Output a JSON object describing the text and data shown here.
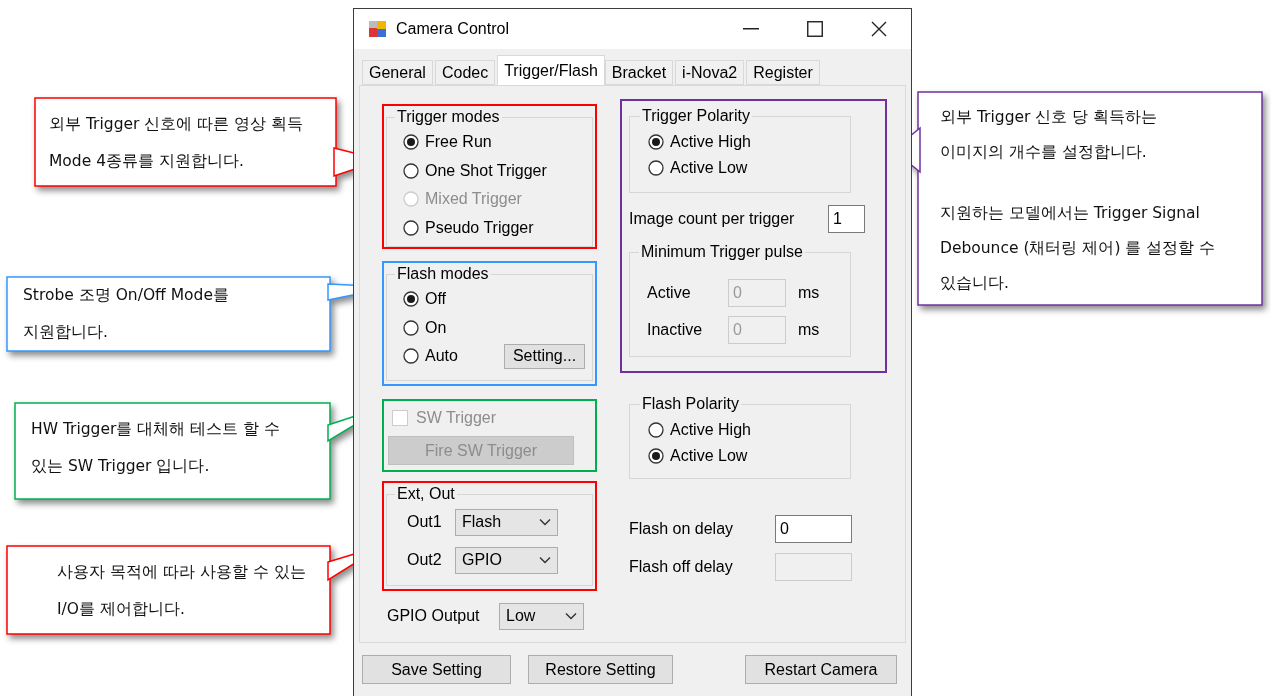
{
  "window": {
    "title": "Camera Control"
  },
  "tabs": [
    {
      "label": "General",
      "selected": false
    },
    {
      "label": "Codec",
      "selected": false
    },
    {
      "label": "Trigger/Flash",
      "selected": true
    },
    {
      "label": "Bracket",
      "selected": false
    },
    {
      "label": "i-Nova2",
      "selected": false
    },
    {
      "label": "Register",
      "selected": false
    }
  ],
  "trigger_modes": {
    "title": "Trigger modes",
    "options": [
      {
        "label": "Free Run",
        "selected": true,
        "disabled": false
      },
      {
        "label": "One Shot Trigger",
        "selected": false,
        "disabled": false
      },
      {
        "label": "Mixed Trigger",
        "selected": false,
        "disabled": true
      },
      {
        "label": "Pseudo Trigger",
        "selected": false,
        "disabled": false
      }
    ]
  },
  "flash_modes": {
    "title": "Flash modes",
    "options": [
      {
        "label": "Off",
        "selected": true,
        "disabled": false
      },
      {
        "label": "On",
        "selected": false,
        "disabled": false
      },
      {
        "label": "Auto",
        "selected": false,
        "disabled": false
      }
    ],
    "setting_button": "Setting..."
  },
  "sw_trigger": {
    "label": "SW Trigger",
    "checked": false,
    "disabled": true,
    "button": "Fire SW Trigger"
  },
  "ext_out": {
    "title": "Ext, Out",
    "outputs": [
      {
        "label": "Out1",
        "value": "Flash"
      },
      {
        "label": "Out2",
        "value": "GPIO"
      }
    ]
  },
  "gpio_output": {
    "label": "GPIO Output",
    "value": "Low"
  },
  "trigger_polarity": {
    "title": "Trigger Polarity",
    "options": [
      {
        "label": "Active High",
        "selected": true
      },
      {
        "label": "Active Low",
        "selected": false
      }
    ]
  },
  "image_count": {
    "label": "Image count per trigger",
    "value": "1"
  },
  "min_trigger_pulse": {
    "title": "Minimum Trigger pulse",
    "rows": [
      {
        "label": "Active",
        "value": "0",
        "unit": "ms",
        "disabled": true
      },
      {
        "label": "Inactive",
        "value": "0",
        "unit": "ms",
        "disabled": true
      }
    ]
  },
  "flash_polarity": {
    "title": "Flash Polarity",
    "options": [
      {
        "label": "Active High",
        "selected": false
      },
      {
        "label": "Active Low",
        "selected": true
      }
    ]
  },
  "flash_delays": [
    {
      "label": "Flash on delay",
      "value": "0",
      "disabled": false
    },
    {
      "label": "Flash off delay",
      "disabled": true
    }
  ],
  "buttons": [
    "Save Setting",
    "Restore Setting",
    "Restart Camera"
  ],
  "callouts": [
    {
      "paragraphs": [
        "외부 Trigger 신호에 따른 영상 획득 Mode 4종류를 지원합니다."
      ],
      "color": "#ff0000"
    },
    {
      "paragraphs": [
        "Strobe 조명 On/Off Mode를 지원합니다."
      ],
      "color": "#3399ff"
    },
    {
      "paragraphs": [
        "HW Trigger를 대체해 테스트 할 수 있는 SW Trigger 입니다."
      ],
      "color": "#00b050"
    },
    {
      "paragraphs": [
        "사용자 목적에 따라 사용할 수 있는 I/O를 제어합니다."
      ],
      "color": "#ff0000"
    },
    {
      "paragraphs": [
        "외부 Trigger 신호 당 획득하는 이미지의 개수를 설정합니다.",
        "지원하는 모델에서는 Trigger Signal Debounce (채터링 제어) 를 설정할 수 있습니다."
      ],
      "color": "#7030a0"
    }
  ]
}
